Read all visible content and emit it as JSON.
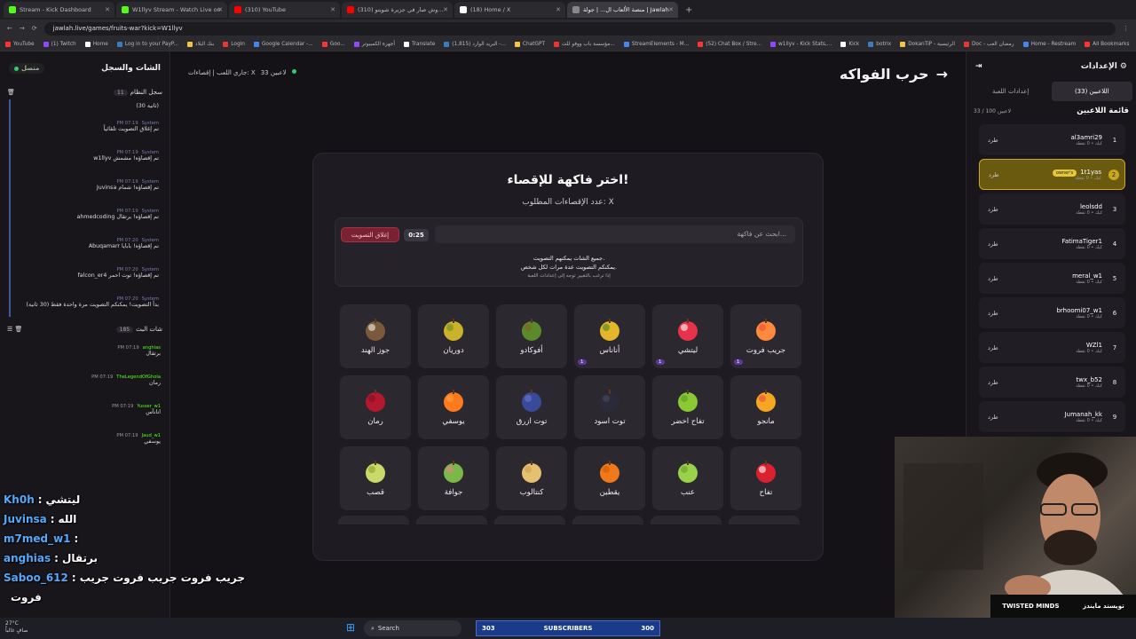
{
  "browser": {
    "tabs": [
      {
        "label": "Stream - Kick Dashboard",
        "color": "#53fc18"
      },
      {
        "label": "W1llyv Stream - Watch Live on",
        "color": "#53fc18"
      },
      {
        "label": "(310) YouTube",
        "color": "#ff0000"
      },
      {
        "label": "(310) وش صار في جزيرة شويتو...",
        "color": "#ff0000"
      },
      {
        "label": "(18) Home / X",
        "color": "#ffffff"
      },
      {
        "label": "منصة الألعاب ال... | جولة | Jawlah",
        "color": "#888888"
      }
    ],
    "url": "jawlah.live/games/fruits-war?kick=W1llyv",
    "bookmarks": [
      "YouTube",
      "(1) Twitch",
      "Home",
      "Log in to your PayP...",
      "بنك البلاد",
      "Login",
      "Google Calendar -...",
      "Goo...",
      "أجهزة الكمبيوتر",
      "Translate",
      "(1,815) البريد الوارد -...",
      "ChatGPT",
      "مؤسسة باب ووفو للت...",
      "StreamElements - M...",
      "(52) Chat Box / Stre...",
      "w1llyv - Kick Stats,...",
      "Kick",
      "botrix",
      "DokanTiP - الرئيسية",
      "Doc - رمضان الغب",
      "Home - Restream",
      "All Bookmarks"
    ]
  },
  "left": {
    "title": "الشات والسجل",
    "online": "متصل",
    "system_log": {
      "title": "سجل النظام",
      "count": "11"
    },
    "system_messages": [
      {
        "time": "",
        "text": "(30 ثانية)"
      },
      {
        "time": "PM 07:19",
        "user": "System",
        "text": "تم إغلاق التصويت تلقائياً"
      },
      {
        "time": "PM 07:19",
        "user": "System",
        "text": "w1llyv تم إقصاؤه! مشمش"
      },
      {
        "time": "PM 07:19",
        "user": "System",
        "text": "Juvinsa تم إقصاؤه! شمام"
      },
      {
        "time": "PM 07:19",
        "user": "System",
        "text": "ahmedcoding تم إقصاؤه! برتقال"
      },
      {
        "time": "PM 07:20",
        "user": "System",
        "text": "Abuqamarr تم إقصاؤه! بابايا"
      },
      {
        "time": "PM 07:20",
        "user": "System",
        "text": "falcon_er4 تم إقصاؤه! توت احمر"
      },
      {
        "time": "PM 07:20",
        "user": "System",
        "text": "بدأ التصويت! يمكنكم التصويت مرة واحدة فقط (30 ثانية)"
      }
    ],
    "chat": {
      "title": "شات البث",
      "count": "185"
    },
    "chat_messages": [
      {
        "time": "PM 07:19",
        "user": "anghias",
        "text": "برتقال"
      },
      {
        "time": "PM 07:19",
        "user": "TheLegendOfGhola",
        "text": "رمان"
      },
      {
        "time": "PM 07:19",
        "user": "Yusser_w1",
        "text": "اناناس"
      },
      {
        "time": "PM 07:19",
        "user": "Jaud_w1",
        "text": "يوسفي"
      }
    ],
    "overlay": [
      {
        "name": "Kh0h",
        "text": "ليتشي"
      },
      {
        "name": "Juvinsa",
        "text": "الله"
      },
      {
        "name": "m7med_w1",
        "text": ""
      },
      {
        "name": "anghias",
        "text": "برتقال"
      },
      {
        "name": "Saboo_612",
        "text": "جريب فروت جريب فروت جريب"
      },
      {
        "name": "",
        "text": "فروت"
      }
    ]
  },
  "center": {
    "status_players": "33 لاعبين",
    "status_text": "جاري اللعب | إقصاءات: X",
    "game_title": "حرب الفواكه",
    "card": {
      "title": "اختر فاكهة للإقصاء!",
      "subtitle": "عدد الإقصاءات المطلوب: X",
      "search_placeholder": "ابحث عن فاكهة...",
      "timer": "0:25",
      "close_vote": "إغلاق التصويت",
      "note1": "جميع الشات يمكنهم التصويت.",
      "note2": "يمكنكم التصويت عدة مرات لكل شخص.",
      "note3": "إذا ترغب بالتغيير توجه إلى إعدادات اللعبة"
    },
    "fruits": [
      {
        "label": "جريب فروت",
        "icon": "grapefruit-icon",
        "tag": "1"
      },
      {
        "label": "ليتشي",
        "icon": "lychee-icon",
        "tag": "1"
      },
      {
        "label": "أناناس",
        "icon": "pineapple-icon",
        "tag": "1"
      },
      {
        "label": "أفوكادو",
        "icon": "avocado-icon",
        "tag": ""
      },
      {
        "label": "دوريان",
        "icon": "durian-icon",
        "tag": ""
      },
      {
        "label": "جوز الهند",
        "icon": "coconut-icon",
        "tag": ""
      },
      {
        "label": "مانجو",
        "icon": "mango-icon",
        "tag": ""
      },
      {
        "label": "تفاح اخضر",
        "icon": "green-apple-icon",
        "tag": ""
      },
      {
        "label": "توت اسود",
        "icon": "blackberry-icon",
        "tag": ""
      },
      {
        "label": "توت ازرق",
        "icon": "blueberry-icon",
        "tag": ""
      },
      {
        "label": "يوسفي",
        "icon": "tangerine-icon",
        "tag": ""
      },
      {
        "label": "رمان",
        "icon": "pomegranate-icon",
        "tag": ""
      },
      {
        "label": "تفاح",
        "icon": "apple-icon",
        "tag": ""
      },
      {
        "label": "عنب",
        "icon": "grapes-icon",
        "tag": ""
      },
      {
        "label": "يقطين",
        "icon": "pumpkin-icon",
        "tag": ""
      },
      {
        "label": "كنتالوب",
        "icon": "cantaloupe-icon",
        "tag": ""
      },
      {
        "label": "جوافة",
        "icon": "guava-icon",
        "tag": ""
      },
      {
        "label": "قصب",
        "icon": "sugarcane-icon",
        "tag": ""
      }
    ]
  },
  "right": {
    "title": "الإعدادات",
    "tab_players": "اللاعبين (33)",
    "tab_settings": "إعدادات اللعبة",
    "list_title": "قائمة اللاعبين",
    "list_count": "33 / 100 لاعبين",
    "kick_label": "طرد",
    "owner_label": "owner's",
    "points": "كيك • 0 نقطة",
    "players": [
      {
        "rank": "1",
        "name": "al3amri29"
      },
      {
        "rank": "2",
        "name": "1t1yas"
      },
      {
        "rank": "3",
        "name": "leolsdd"
      },
      {
        "rank": "4",
        "name": "FatimaTiger1"
      },
      {
        "rank": "5",
        "name": "meral_w1"
      },
      {
        "rank": "6",
        "name": "brhoomi07_w1"
      },
      {
        "rank": "7",
        "name": "WZl1"
      },
      {
        "rank": "8",
        "name": "twx_b52"
      },
      {
        "rank": "9",
        "name": "Jumanah_kk"
      }
    ]
  },
  "taskbar": {
    "weather_temp": "27°C",
    "weather_text": "صافٍ غالباً",
    "search": "Search",
    "sub_left": "303",
    "sub_mid": "SUBSCRIBERS",
    "sub_right": "300"
  },
  "webcam": {
    "brand1": "TWISTED MINDS",
    "brand2": "تويستد مايندز"
  }
}
